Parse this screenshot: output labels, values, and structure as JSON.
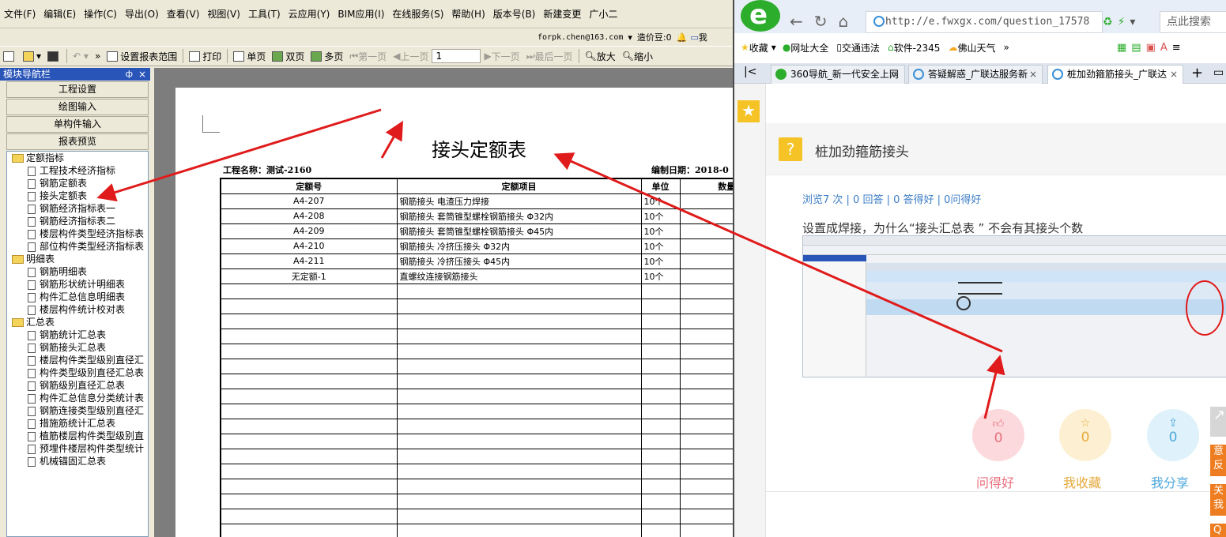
{
  "app": {
    "menu": [
      "文件(F)",
      "编辑(E)",
      "操作(C)",
      "导出(O)",
      "查看(V)",
      "视图(V)",
      "工具(T)",
      "云应用(Y)",
      "BIM应用(I)",
      "在线服务(S)",
      "帮助(H)",
      "版本号(B)",
      "新建变更",
      "广小二"
    ],
    "account": "forpk.chen@163.com",
    "price_beans": "造价豆:0",
    "me_label": "我",
    "toolbar": {
      "set_range": "设置报表范围",
      "print": "打印",
      "single": "单页",
      "double": "双页",
      "multi": "多页",
      "first": "第一页",
      "prev": "上一页",
      "page_num": "1",
      "next": "下一页",
      "last": "最后一页",
      "zoom_in": "放大",
      "zoom_out": "缩小"
    },
    "nav": {
      "title": "模块导航栏",
      "pin": "ф",
      "close": "×",
      "buttons": [
        "工程设置",
        "绘图输入",
        "单构件输入",
        "报表预览"
      ],
      "tree": [
        {
          "type": "folder",
          "label": "定额指标"
        },
        {
          "type": "doc",
          "label": "工程技术经济指标"
        },
        {
          "type": "doc",
          "label": "钢筋定额表"
        },
        {
          "type": "doc",
          "label": "接头定额表"
        },
        {
          "type": "doc",
          "label": "钢筋经济指标表一"
        },
        {
          "type": "doc",
          "label": "钢筋经济指标表二"
        },
        {
          "type": "doc",
          "label": "楼层构件类型经济指标表"
        },
        {
          "type": "doc",
          "label": "部位构件类型经济指标表"
        },
        {
          "type": "folder",
          "label": "明细表"
        },
        {
          "type": "doc",
          "label": "钢筋明细表"
        },
        {
          "type": "doc",
          "label": "钢筋形状统计明细表"
        },
        {
          "type": "doc",
          "label": "构件汇总信息明细表"
        },
        {
          "type": "doc",
          "label": "楼层构件统计校对表"
        },
        {
          "type": "folder",
          "label": "汇总表"
        },
        {
          "type": "doc",
          "label": "钢筋统计汇总表"
        },
        {
          "type": "doc",
          "label": "钢筋接头汇总表"
        },
        {
          "type": "doc",
          "label": "楼层构件类型级别直径汇"
        },
        {
          "type": "doc",
          "label": "构件类型级别直径汇总表"
        },
        {
          "type": "doc",
          "label": "钢筋级别直径汇总表"
        },
        {
          "type": "doc",
          "label": "构件汇总信息分类统计表"
        },
        {
          "type": "doc",
          "label": "钢筋连接类型级别直径汇"
        },
        {
          "type": "doc",
          "label": "措施筋统计汇总表"
        },
        {
          "type": "doc",
          "label": "植筋楼层构件类型级别直"
        },
        {
          "type": "doc",
          "label": "预埋件楼层构件类型统计"
        },
        {
          "type": "doc",
          "label": "机械锚固汇总表"
        }
      ]
    },
    "report": {
      "title": "接头定额表",
      "project_name": "工程名称：测试-2160",
      "edit_date": "编制日期：2018-0",
      "headers": [
        "定额号",
        "定额项目",
        "单位",
        "数量"
      ],
      "rows": [
        [
          "A4-207",
          "钢筋接头 电渣压力焊接",
          "10个",
          ""
        ],
        [
          "A4-208",
          "钢筋接头 套筒锥型螺栓钢筋接头 Φ32内",
          "10个",
          ""
        ],
        [
          "A4-209",
          "钢筋接头 套筒锥型螺栓钢筋接头 Φ45内",
          "10个",
          ""
        ],
        [
          "A4-210",
          "钢筋接头 冷挤压接头  Φ32内",
          "10个",
          ""
        ],
        [
          "A4-211",
          "钢筋接头 冷挤压接头  Φ45内",
          "10个",
          ""
        ],
        [
          "无定额-1",
          "直螺纹连接钢筋接头",
          "10个",
          ""
        ]
      ],
      "empty_rows": 17
    }
  },
  "browser": {
    "address": "http://e.fwxgx.com/question_17578",
    "search_placeholder": "点此搜索",
    "favorites": [
      "收藏",
      "网址大全",
      "交通违法",
      "软件-2345",
      "佛山天气",
      "»"
    ],
    "tabs": [
      "360导航_新一代安全上网",
      "答疑解惑_广联达服务新",
      "桩加劲箍筋接头_广联达"
    ],
    "question": {
      "title": "桩加劲箍筋接头",
      "stats": "浏览7 次 | 0 回答 | 0 答得好 | 0问得好",
      "body": "设置成焊接，为什么“接头汇总表 ”  不会有其接头个数",
      "ask_good_count": "0",
      "ask_good_label": "问得好",
      "fav_count": "0",
      "fav_label": "我收藏",
      "share_count": "0",
      "share_label": "我分享",
      "side_items": [
        "意反",
        "关我",
        "Q"
      ]
    }
  },
  "colors": {
    "arrow": "#e01b1b",
    "nav_header": "#2a55b8",
    "accent_green": "#2cad2c",
    "star": "#f5c325",
    "link": "#3d7ec6"
  }
}
